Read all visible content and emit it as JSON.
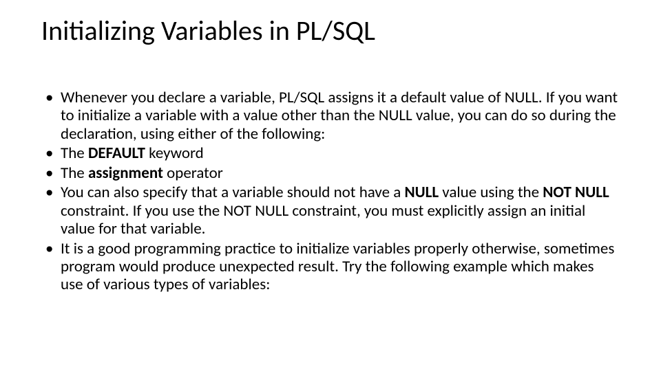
{
  "slide": {
    "title": "Initializing Variables in PL/SQL",
    "bullets": [
      "Whenever you declare a variable, PL/SQL assigns it a default value of NULL. If you want to initialize a variable with a value other than the NULL value, you can do so during the declaration, using either of the following:",
      "The <b>DEFAULT</b> keyword",
      "The <b>assignment</b> operator",
      "You can also specify that a variable should not have a <b>NULL</b> value using the <b>NOT NULL</b> constraint. If you use the NOT NULL constraint, you must explicitly assign an initial value for that variable.",
      "It is a good programming practice to initialize variables properly otherwise, sometimes program would produce unexpected result. Try the following example which makes use of various types of variables:"
    ]
  }
}
